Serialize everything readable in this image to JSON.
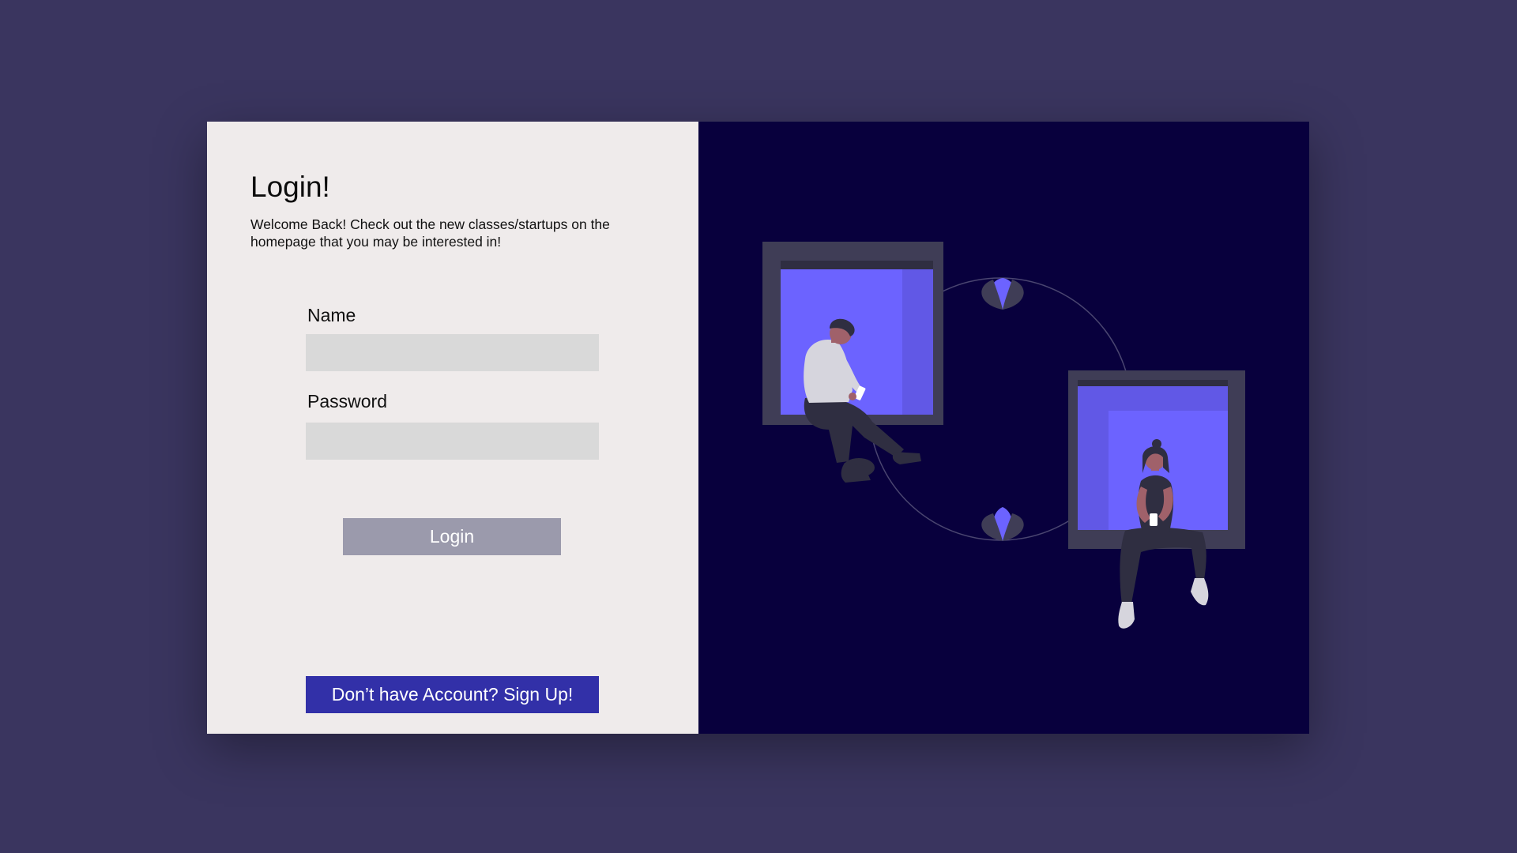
{
  "login": {
    "title": "Login!",
    "subtitle": "Welcome Back! Check out the new classes/startups on the homepage that you may be interested in!",
    "name_label": "Name",
    "name_value": "",
    "password_label": "Password",
    "password_value": "",
    "login_button": "Login",
    "signup_button": "Don’t have Account? Sign Up!"
  },
  "illustration": {
    "name": "people-sitting-in-windows-illustration"
  },
  "colors": {
    "page_background": "#3a355f",
    "left_panel": "#efebeb",
    "right_panel": "#08003d",
    "input_background": "#d9d9d9",
    "login_button": "#9b9aac",
    "signup_button": "#3230a8",
    "accent": "#6c63ff"
  }
}
